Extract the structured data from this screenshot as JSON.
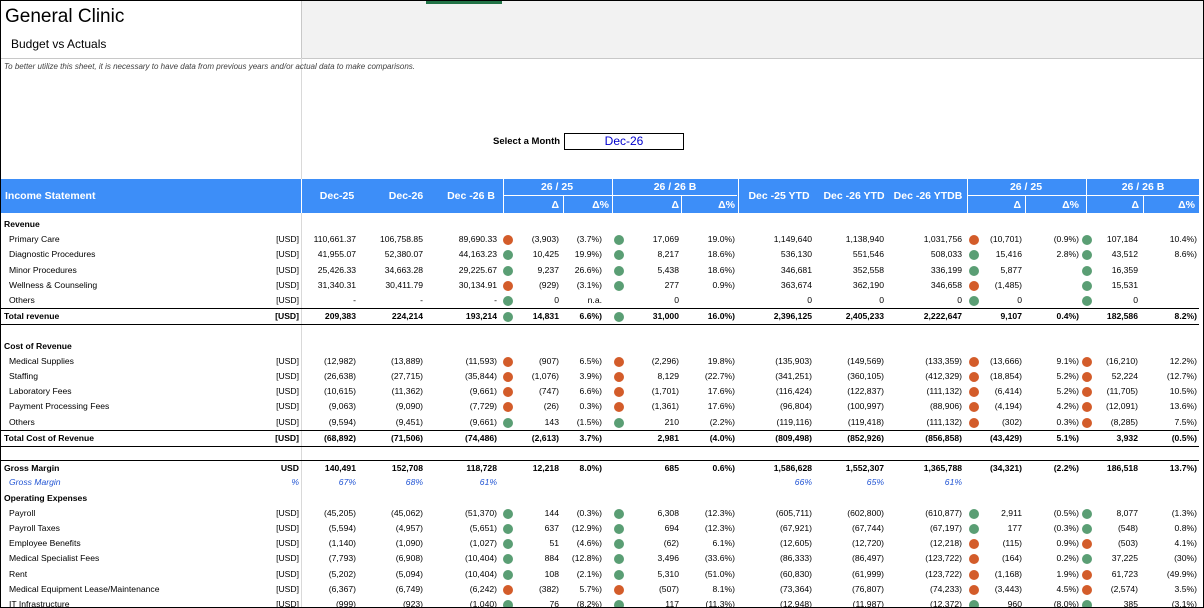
{
  "title": "General Clinic",
  "subtitle": "Budget vs Actuals",
  "note": "To better utilize this sheet, it is necessary to have data from previous years and/or actual data to make comparisons.",
  "selector": {
    "label": "Select a Month",
    "value": "Dec-26"
  },
  "header": {
    "section_title": "Income Statement",
    "col_prev": "Dec-25",
    "col_curr": "Dec-26",
    "col_budget": "Dec -26 B",
    "group1": "26 / 25",
    "group2": "26 / 26 B",
    "col_prev_ytd": "Dec -25 YTD",
    "col_curr_ytd": "Dec -26 YTD",
    "col_budget_ytd": "Dec -26 YTDB",
    "group3": "26 / 25",
    "group4": "26 / 26 B",
    "delta": "Δ",
    "delta_pct": "Δ%"
  },
  "colors": {
    "header_bg": "#3d8ef8",
    "dot_green": "#5a9e74",
    "dot_orange": "#d35c2a",
    "gross_margin_pct": "#2255d4"
  },
  "rows": [
    {
      "type": "section",
      "label": "Revenue"
    },
    {
      "type": "line",
      "label": "Primary Care",
      "unit": "[USD]",
      "v": [
        "110,661.37",
        "106,758.85",
        "89,690.33",
        "(3,903)",
        "(3.7%)",
        "17,069",
        "19.0%)",
        "1,149,640",
        "1,138,940",
        "1,031,756",
        "(10,701)",
        "(0.9%)",
        "107,184",
        "10.4%)"
      ],
      "dots": [
        "o",
        "g",
        "",
        "o",
        "g",
        ""
      ]
    },
    {
      "type": "line",
      "label": "Diagnostic Procedures",
      "unit": "[USD]",
      "v": [
        "41,955.07",
        "52,380.07",
        "44,163.23",
        "10,425",
        "19.9%)",
        "8,217",
        "18.6%)",
        "536,130",
        "551,546",
        "508,033",
        "15,416",
        "2.8%)",
        "43,512",
        "8.6%)"
      ],
      "dots": [
        "g",
        "g",
        "",
        "g",
        "g",
        ""
      ]
    },
    {
      "type": "line",
      "label": "Minor Procedures",
      "unit": "[USD]",
      "v": [
        "25,426.33",
        "34,663.28",
        "29,225.67",
        "9,237",
        "26.6%)",
        "5,438",
        "18.6%)",
        "346,681",
        "352,558",
        "336,199",
        "5,877",
        "",
        "16,359",
        ""
      ],
      "dots": [
        "g",
        "g",
        "",
        "g",
        "g",
        ""
      ]
    },
    {
      "type": "line",
      "label": "Wellness & Counseling",
      "unit": "[USD]",
      "v": [
        "31,340.31",
        "30,411.79",
        "30,134.91",
        "(929)",
        "(3.1%)",
        "277",
        "0.9%)",
        "363,674",
        "362,190",
        "346,658",
        "(1,485)",
        "",
        "15,531",
        ""
      ],
      "dots": [
        "o",
        "g",
        "",
        "o",
        "g",
        ""
      ]
    },
    {
      "type": "line",
      "label": "Others",
      "unit": "[USD]",
      "v": [
        "-",
        "-",
        "-",
        "0",
        "n.a.",
        "0",
        "",
        "0",
        "0",
        "0",
        "0",
        "",
        "0",
        ""
      ],
      "dots": [
        "g",
        "",
        "",
        "g",
        "g",
        ""
      ]
    },
    {
      "type": "total",
      "label": "Total revenue",
      "unit": "[USD]",
      "v": [
        "209,383",
        "224,214",
        "193,214",
        "14,831",
        "6.6%)",
        "31,000",
        "16.0%)",
        "2,396,125",
        "2,405,233",
        "2,222,647",
        "9,107",
        "0.4%)",
        "182,586",
        "8.2%)"
      ],
      "dots": [
        "g",
        "g",
        "",
        "",
        "",
        ""
      ]
    },
    {
      "type": "blank"
    },
    {
      "type": "section",
      "label": "Cost  of Revenue"
    },
    {
      "type": "line",
      "label": "Medical Supplies",
      "unit": "[USD]",
      "v": [
        "(12,982)",
        "(13,889)",
        "(11,593)",
        "(907)",
        "6.5%)",
        "(2,296)",
        "19.8%)",
        "(135,903)",
        "(149,569)",
        "(133,359)",
        "(13,666)",
        "9.1%)",
        "(16,210)",
        "12.2%)"
      ],
      "dots": [
        "o",
        "o",
        "",
        "o",
        "o",
        ""
      ]
    },
    {
      "type": "line",
      "label": "Staffing",
      "unit": "[USD]",
      "v": [
        "(26,638)",
        "(27,715)",
        "(35,844)",
        "(1,076)",
        "3.9%)",
        "8,129",
        "(22.7%)",
        "(341,251)",
        "(360,105)",
        "(412,329)",
        "(18,854)",
        "5.2%)",
        "52,224",
        "(12.7%)"
      ],
      "dots": [
        "o",
        "o",
        "",
        "o",
        "o",
        ""
      ]
    },
    {
      "type": "line",
      "label": "Laboratory Fees",
      "unit": "[USD]",
      "v": [
        "(10,615)",
        "(11,362)",
        "(9,661)",
        "(747)",
        "6.6%)",
        "(1,701)",
        "17.6%)",
        "(116,424)",
        "(122,837)",
        "(111,132)",
        "(6,414)",
        "5.2%)",
        "(11,705)",
        "10.5%)"
      ],
      "dots": [
        "o",
        "o",
        "",
        "o",
        "o",
        ""
      ]
    },
    {
      "type": "line",
      "label": "Payment Processing Fees",
      "unit": "[USD]",
      "v": [
        "(9,063)",
        "(9,090)",
        "(7,729)",
        "(26)",
        "0.3%)",
        "(1,361)",
        "17.6%)",
        "(96,804)",
        "(100,997)",
        "(88,906)",
        "(4,194)",
        "4.2%)",
        "(12,091)",
        "13.6%)"
      ],
      "dots": [
        "o",
        "o",
        "",
        "o",
        "o",
        ""
      ]
    },
    {
      "type": "line",
      "label": "Others",
      "unit": "[USD]",
      "v": [
        "(9,594)",
        "(9,451)",
        "(9,661)",
        "143",
        "(1.5%)",
        "210",
        "(2.2%)",
        "(119,116)",
        "(119,418)",
        "(111,132)",
        "(302)",
        "0.3%)",
        "(8,285)",
        "7.5%)"
      ],
      "dots": [
        "g",
        "g",
        "",
        "o",
        "o",
        ""
      ]
    },
    {
      "type": "total",
      "label": "Total Cost of Revenue",
      "unit": "[USD]",
      "v": [
        "(68,892)",
        "(71,506)",
        "(74,486)",
        "(2,613)",
        "3.7%)",
        "2,981",
        "(4.0%)",
        "(809,498)",
        "(852,926)",
        "(856,858)",
        "(43,429)",
        "5.1%)",
        "3,932",
        "(0.5%)"
      ],
      "dots": [
        "",
        "",
        "",
        "",
        "",
        ""
      ]
    },
    {
      "type": "blank"
    },
    {
      "type": "gross",
      "label": "Gross Margin",
      "unit": "USD",
      "v": [
        "140,491",
        "152,708",
        "118,728",
        "12,218",
        "8.0%)",
        "685",
        "0.6%)",
        "1,586,628",
        "1,552,307",
        "1,365,788",
        "(34,321)",
        "(2.2%)",
        "186,518",
        "13.7%)"
      ],
      "dots": [
        "",
        "",
        "",
        "",
        "",
        ""
      ]
    },
    {
      "type": "pct",
      "label": "Gross Margin",
      "unit": "%",
      "v": [
        "67%",
        "68%",
        "61%",
        "",
        "",
        "",
        "",
        "66%",
        "65%",
        "61%",
        "",
        "",
        "",
        ""
      ],
      "dots": [
        "",
        "",
        "",
        "",
        "",
        ""
      ]
    },
    {
      "type": "section",
      "label": "Operating Expenses"
    },
    {
      "type": "line",
      "label": "Payroll",
      "unit": "[USD]",
      "v": [
        "(45,205)",
        "(45,062)",
        "(51,370)",
        "144",
        "(0.3%)",
        "6,308",
        "(12.3%)",
        "(605,711)",
        "(602,800)",
        "(610,877)",
        "2,911",
        "(0.5%)",
        "8,077",
        "(1.3%)"
      ],
      "dots": [
        "g",
        "g",
        "",
        "g",
        "g",
        ""
      ]
    },
    {
      "type": "line",
      "label": "Payroll Taxes",
      "unit": "[USD]",
      "v": [
        "(5,594)",
        "(4,957)",
        "(5,651)",
        "637",
        "(12.9%)",
        "694",
        "(12.3%)",
        "(67,921)",
        "(67,744)",
        "(67,197)",
        "177",
        "(0.3%)",
        "(548)",
        "0.8%)"
      ],
      "dots": [
        "g",
        "g",
        "",
        "g",
        "g",
        ""
      ]
    },
    {
      "type": "line",
      "label": "Employee Benefits",
      "unit": "[USD]",
      "v": [
        "(1,140)",
        "(1,090)",
        "(1,027)",
        "51",
        "(4.6%)",
        "(62)",
        "6.1%)",
        "(12,605)",
        "(12,720)",
        "(12,218)",
        "(115)",
        "0.9%)",
        "(503)",
        "4.1%)"
      ],
      "dots": [
        "g",
        "g",
        "",
        "o",
        "o",
        ""
      ]
    },
    {
      "type": "line",
      "label": "Medical Specialist Fees",
      "unit": "[USD]",
      "v": [
        "(7,793)",
        "(6,908)",
        "(10,404)",
        "884",
        "(12.8%)",
        "3,496",
        "(33.6%)",
        "(86,333)",
        "(86,497)",
        "(123,722)",
        "(164)",
        "0.2%)",
        "37,225",
        "(30%)"
      ],
      "dots": [
        "g",
        "g",
        "",
        "o",
        "g",
        ""
      ]
    },
    {
      "type": "line",
      "label": "Rent",
      "unit": "[USD]",
      "v": [
        "(5,202)",
        "(5,094)",
        "(10,404)",
        "108",
        "(2.1%)",
        "5,310",
        "(51.0%)",
        "(60,830)",
        "(61,999)",
        "(123,722)",
        "(1,168)",
        "1.9%)",
        "61,723",
        "(49.9%)"
      ],
      "dots": [
        "g",
        "g",
        "",
        "o",
        "o",
        ""
      ]
    },
    {
      "type": "line",
      "label": "Medical Equipment Lease/Maintenance",
      "unit": "[USD]",
      "v": [
        "(6,367)",
        "(6,749)",
        "(6,242)",
        "(382)",
        "5.7%)",
        "(507)",
        "8.1%)",
        "(73,364)",
        "(76,807)",
        "(74,233)",
        "(3,443)",
        "4.5%)",
        "(2,574)",
        "3.5%)"
      ],
      "dots": [
        "o",
        "o",
        "",
        "o",
        "o",
        ""
      ]
    },
    {
      "type": "line",
      "label": "IT Infrastructure",
      "unit": "[USD]",
      "v": [
        "(999)",
        "(923)",
        "(1,040)",
        "76",
        "(8.2%)",
        "117",
        "(11.3%)",
        "(12,948)",
        "(11,987)",
        "(12,372)",
        "960",
        "(8.0%)",
        "385",
        "(3.1%)"
      ],
      "dots": [
        "g",
        "g",
        "",
        "g",
        "g",
        ""
      ]
    }
  ]
}
